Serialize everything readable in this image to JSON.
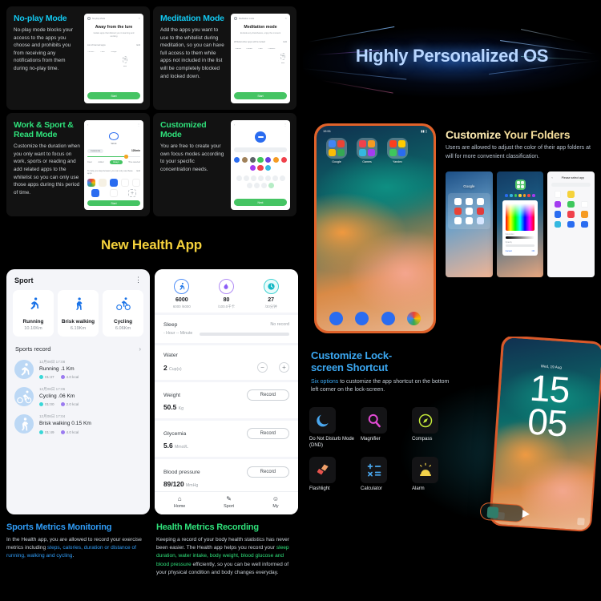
{
  "modes": [
    {
      "id": "no-play",
      "title": "No-play Mode",
      "title_color": "cyan",
      "desc": "No-play mode blocks your access to the apps you choose and prohibits you from receiving any notifications from them during no-play time.",
      "phone": {
        "header": "No-play Mode",
        "heading": "Away from the lure",
        "sub": "Isolate apps that distract you in learning and working",
        "list_label": "List of banned apps",
        "list_action": "Edit",
        "apps": [
          "Calcula...",
          "Clock",
          "Google",
          "Add"
        ],
        "button": "Start"
      }
    },
    {
      "id": "meditation",
      "title": "Meditation Mode",
      "title_color": "cyan",
      "desc": "Add the apps you want to use to the whitelist during meditation, so you can have full access to them while apps not included in the list will be completely blocked and locked down.",
      "phone": {
        "header": "Meditation mode",
        "heading": "Meditation mode",
        "sub": "Exclude any disturbance, enjoy the moment",
        "list_label": "Whitelist:other apps will be locked",
        "list_action": "Edit",
        "apps": [
          "Camera",
          "Chrome",
          "Clock",
          "Contacts",
          "Add"
        ],
        "button": "Start"
      }
    },
    {
      "id": "work-sport-read",
      "title": "Work & Sport & Read Mode",
      "title_color": "green",
      "desc": "Customize the duration when you only want to focus on work, sports or reading and add related apps to the whitelist so you can only use those apps during this period of time.",
      "phone": {
        "label": "Work",
        "pill": "Customize",
        "minutes": "120min",
        "tabs": [
          "Clear",
          "Added",
          "Always",
          "Time selected"
        ],
        "active_tab": "Always",
        "note": "To help you stay focused, you can only use these apps",
        "note_action": "Edit",
        "button": "Start"
      }
    },
    {
      "id": "customized",
      "title": "Customized Mode",
      "title_color": "green",
      "desc": "You are free to create your own focus modes according to your specific concentration needs.",
      "phone": {
        "button": "Next",
        "swatches": [
          "#2a6cf0",
          "#a0815a",
          "#5d6268",
          "#3ec75c",
          "#6a3fe0",
          "#f59a22",
          "#f0414b",
          "#a43cf0",
          "#f0414b",
          "#35b8e0"
        ]
      }
    }
  ],
  "banner": {
    "title": "Highly Personalized OS"
  },
  "folders": {
    "title_a": "Customize",
    "title_b": "Your Folders",
    "desc": "Users are allowed to adjust the color of their app folders at will for more convenient classification.",
    "phone": {
      "time": "15:51",
      "folders": [
        "Google",
        "Games",
        "Yandex"
      ]
    },
    "mini": {
      "folder_open_title": "Google",
      "picker": {
        "label1": "Saturation",
        "label2": "Opacity",
        "cancel": "Cancel",
        "ok": "OK"
      },
      "app_list_title": "Please select app",
      "search_placeholder": "Search apps"
    }
  },
  "health": {
    "section_title": "New Health App",
    "sport": {
      "title": "Sport",
      "tiles": [
        {
          "name": "Running",
          "value": "10.10Km",
          "icon": "running-icon"
        },
        {
          "name": "Brisk walking",
          "value": "6.19Km",
          "icon": "walking-icon"
        },
        {
          "name": "Cycling",
          "value": "6.06Km",
          "icon": "cycling-icon"
        }
      ],
      "record_header": "Sports record",
      "records": [
        {
          "date": "12月08日 17:08",
          "title": "Running  .1 Km",
          "duration": "01:37",
          "calories": "4.0 kcal",
          "icon": "running-icon"
        },
        {
          "date": "12月08日 17:06",
          "title": "Cycling  .06 Km",
          "duration": "01:00",
          "calories": "2.0 kcal",
          "icon": "cycling-icon"
        },
        {
          "date": "12月08日 17:04",
          "title": "Brisk walking 0.15 Km",
          "duration": "01:49",
          "calories": "4.0 kcal",
          "icon": "walking-icon"
        }
      ]
    },
    "summary": {
      "rings": [
        {
          "value": "6000",
          "sub": "6000 /6000",
          "icon": "steps-icon"
        },
        {
          "value": "80",
          "sub": "/100.0千卡",
          "icon": "flame-icon"
        },
        {
          "value": "27",
          "sub": "/30分钟",
          "icon": "clock-icon"
        }
      ],
      "rows": [
        {
          "label": "Sleep",
          "meta": "- Hour -- Minute",
          "status": "No record",
          "type": "sleep"
        },
        {
          "label": "Water",
          "value": "2",
          "unit": "Cup(s)",
          "type": "stepper",
          "minus": "−",
          "plus": "+"
        },
        {
          "label": "Weight",
          "value": "50.5",
          "unit": "Kg",
          "type": "record",
          "action": "Record"
        },
        {
          "label": "Glycemia",
          "value": "5.6",
          "unit": "Mmol/L",
          "type": "record",
          "action": "Record"
        },
        {
          "label": "Blood pressure",
          "value": "89/120",
          "unit": "MmHg",
          "type": "record",
          "action": "Record"
        }
      ],
      "tabs": [
        {
          "label": "Home",
          "icon": "home-icon"
        },
        {
          "label": "Sport",
          "icon": "sport-icon"
        },
        {
          "label": "My",
          "icon": "person-icon"
        }
      ]
    }
  },
  "lockscreen": {
    "title_line1": "Customize Lock-",
    "title_line2": "screen Shortcut",
    "desc_highlight": "Six options",
    "desc_rest": " to customize the app shortcut on the bottom left corner on the lock-screen.",
    "options": [
      {
        "label": "Do Not Disturb Mode (DND)",
        "icon": "moon-icon",
        "color": "#4aa8f0"
      },
      {
        "label": "Magnifier",
        "icon": "magnifier-icon",
        "color": "#e24bd4"
      },
      {
        "label": "Compass",
        "icon": "compass-icon",
        "color": "#c3e83a"
      },
      {
        "label": "Flashlight",
        "icon": "flashlight-icon",
        "color": "#e8534d"
      },
      {
        "label": "Calculator",
        "icon": "calculator-icon",
        "color": "#4aa8f0"
      },
      {
        "label": "Alarm",
        "icon": "alarm-icon",
        "color": "#f2d24a"
      }
    ],
    "phone": {
      "date": "Wed, 19 Aug",
      "hours": "15",
      "minutes": "05"
    }
  },
  "bottom": {
    "left": {
      "title": "Sports Metrics Monitoring",
      "text_a": "In the Health app, you are allowed to record your exercise metrics including ",
      "text_hl": "steps, calories, duration or distance of running, walking and cycling",
      "text_b": "."
    },
    "right": {
      "title": "Health Metrics Recording",
      "text_a": "Keeping a record of your body health statistics has never been easier. The Health app helps you record your ",
      "text_hl": "sleep duration, water intake, body weight, blood glucose and blood pressure",
      "text_b": " efficiently, so you can be well informed of your physical condition and body changes everyday."
    }
  }
}
